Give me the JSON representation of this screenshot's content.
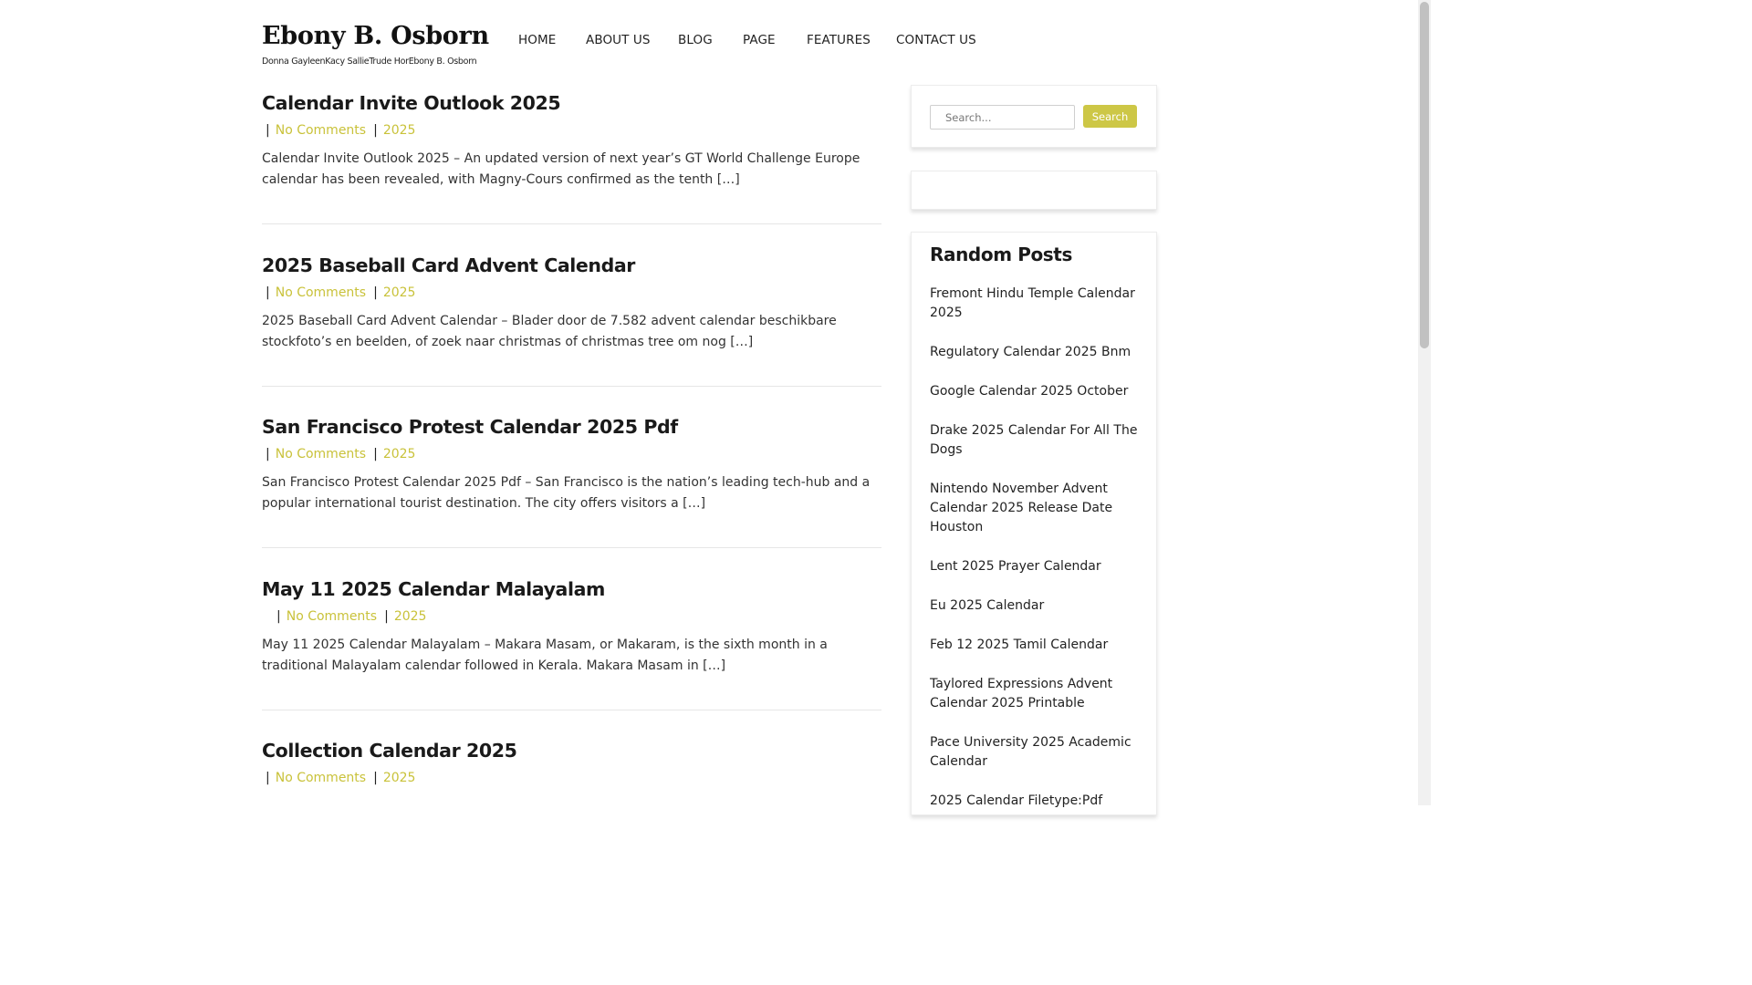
{
  "site": {
    "title": "Ebony B. Osborn",
    "tagline": "Donna GayleenKacy SallieTrude HorEbony B. Osborn"
  },
  "nav": {
    "items": [
      "HOME",
      "ABOUT US",
      "BLOG",
      "PAGE",
      "FEATURES",
      "CONTACT US"
    ]
  },
  "posts": [
    {
      "title": "Calendar Invite Outlook 2025",
      "comments": "No Comments",
      "category": "2025",
      "excerpt": "Calendar Invite Outlook 2025 – An updated version of next year’s GT World Challenge Europe calendar has been revealed, with Magny-Cours confirmed as the tenth […]"
    },
    {
      "title": "2025 Baseball Card Advent Calendar",
      "comments": "No Comments",
      "category": "2025",
      "excerpt": "2025 Baseball Card Advent Calendar – Blader door de 7.582 advent calendar beschikbare stockfoto’s en beelden, of zoek naar christmas of christmas tree om nog […]"
    },
    {
      "title": "San Francisco Protest Calendar 2025 Pdf",
      "comments": "No Comments",
      "category": "2025",
      "excerpt": "San Francisco Protest Calendar 2025 Pdf – San Francisco is the nation’s leading tech-hub and a popular international tourist destination. The city offers visitors a […]"
    },
    {
      "title": "May 11 2025 Calendar Malayalam",
      "comments": "No Comments",
      "category": "2025",
      "excerpt": "May 11 2025 Calendar Malayalam – Makara Masam, or Makaram, is the sixth month in a traditional Malayalam calendar followed in Kerala. Makara Masam in […]"
    },
    {
      "title": "Collection Calendar 2025",
      "comments": "No Comments",
      "category": "2025",
      "excerpt": ""
    }
  ],
  "meta_separator": "|",
  "search": {
    "placeholder": "Search...",
    "button_label": "Search"
  },
  "random_posts": {
    "title": "Random Posts",
    "items": [
      "Fremont Hindu Temple Calendar 2025",
      "Regulatory Calendar 2025 Bnm",
      "Google Calendar 2025 October",
      "Drake 2025 Calendar For All The Dogs",
      "Nintendo November Advent Calendar 2025 Release Date Houston",
      "Lent 2025 Prayer Calendar",
      "Eu 2025 Calendar",
      "Feb 12 2025 Tamil Calendar",
      "Taylored Expressions Advent Calendar 2025 Printable",
      "Pace University 2025 Academic Calendar",
      "2025 Calendar Filetype:Pdf"
    ]
  },
  "colors": {
    "accent": "#cdc746",
    "link": "#c9c23a"
  }
}
